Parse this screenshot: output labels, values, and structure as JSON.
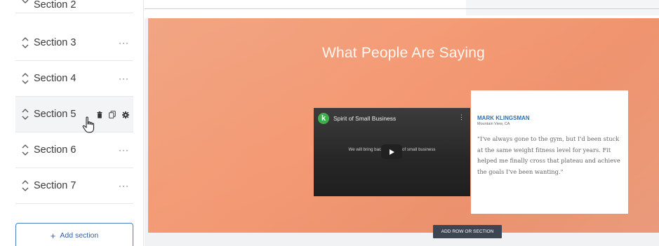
{
  "sidebar": {
    "sections": [
      {
        "label": "Section 2"
      },
      {
        "label": "Section 3"
      },
      {
        "label": "Section 4"
      },
      {
        "label": "Section 5"
      },
      {
        "label": "Section 6"
      },
      {
        "label": "Section 7"
      }
    ],
    "more_glyph": "···",
    "active_section": "Section 5",
    "active_actions": [
      "trash-icon",
      "copy-icon",
      "gear-icon"
    ],
    "add_section": {
      "plus": "+",
      "label": "Add section"
    }
  },
  "canvas": {
    "hero": {
      "title": "What People Are Saying",
      "background_color": "#f39c76"
    },
    "video": {
      "logo_letter": "k",
      "title": "Spirit of Small Business",
      "menu_glyph": "⋮",
      "caption": "We will bring back the spirit of small business"
    },
    "testimonial": {
      "name": "MARK KLINGSMAN",
      "location": "Mountain View, CA",
      "quote": "\"I've always gone to the gym, but I'd been stuck at the same weight fitness level for years. Fit helped me finally cross that plateau and achieve the goals I've been wanting.\""
    },
    "add_row_label": "ADD ROW OR SECTION"
  },
  "colors": {
    "accent_blue": "#2f6fb5",
    "hero_orange": "#f39c76",
    "video_logo_green": "#3fae49",
    "tag_dark": "#3c4550"
  }
}
